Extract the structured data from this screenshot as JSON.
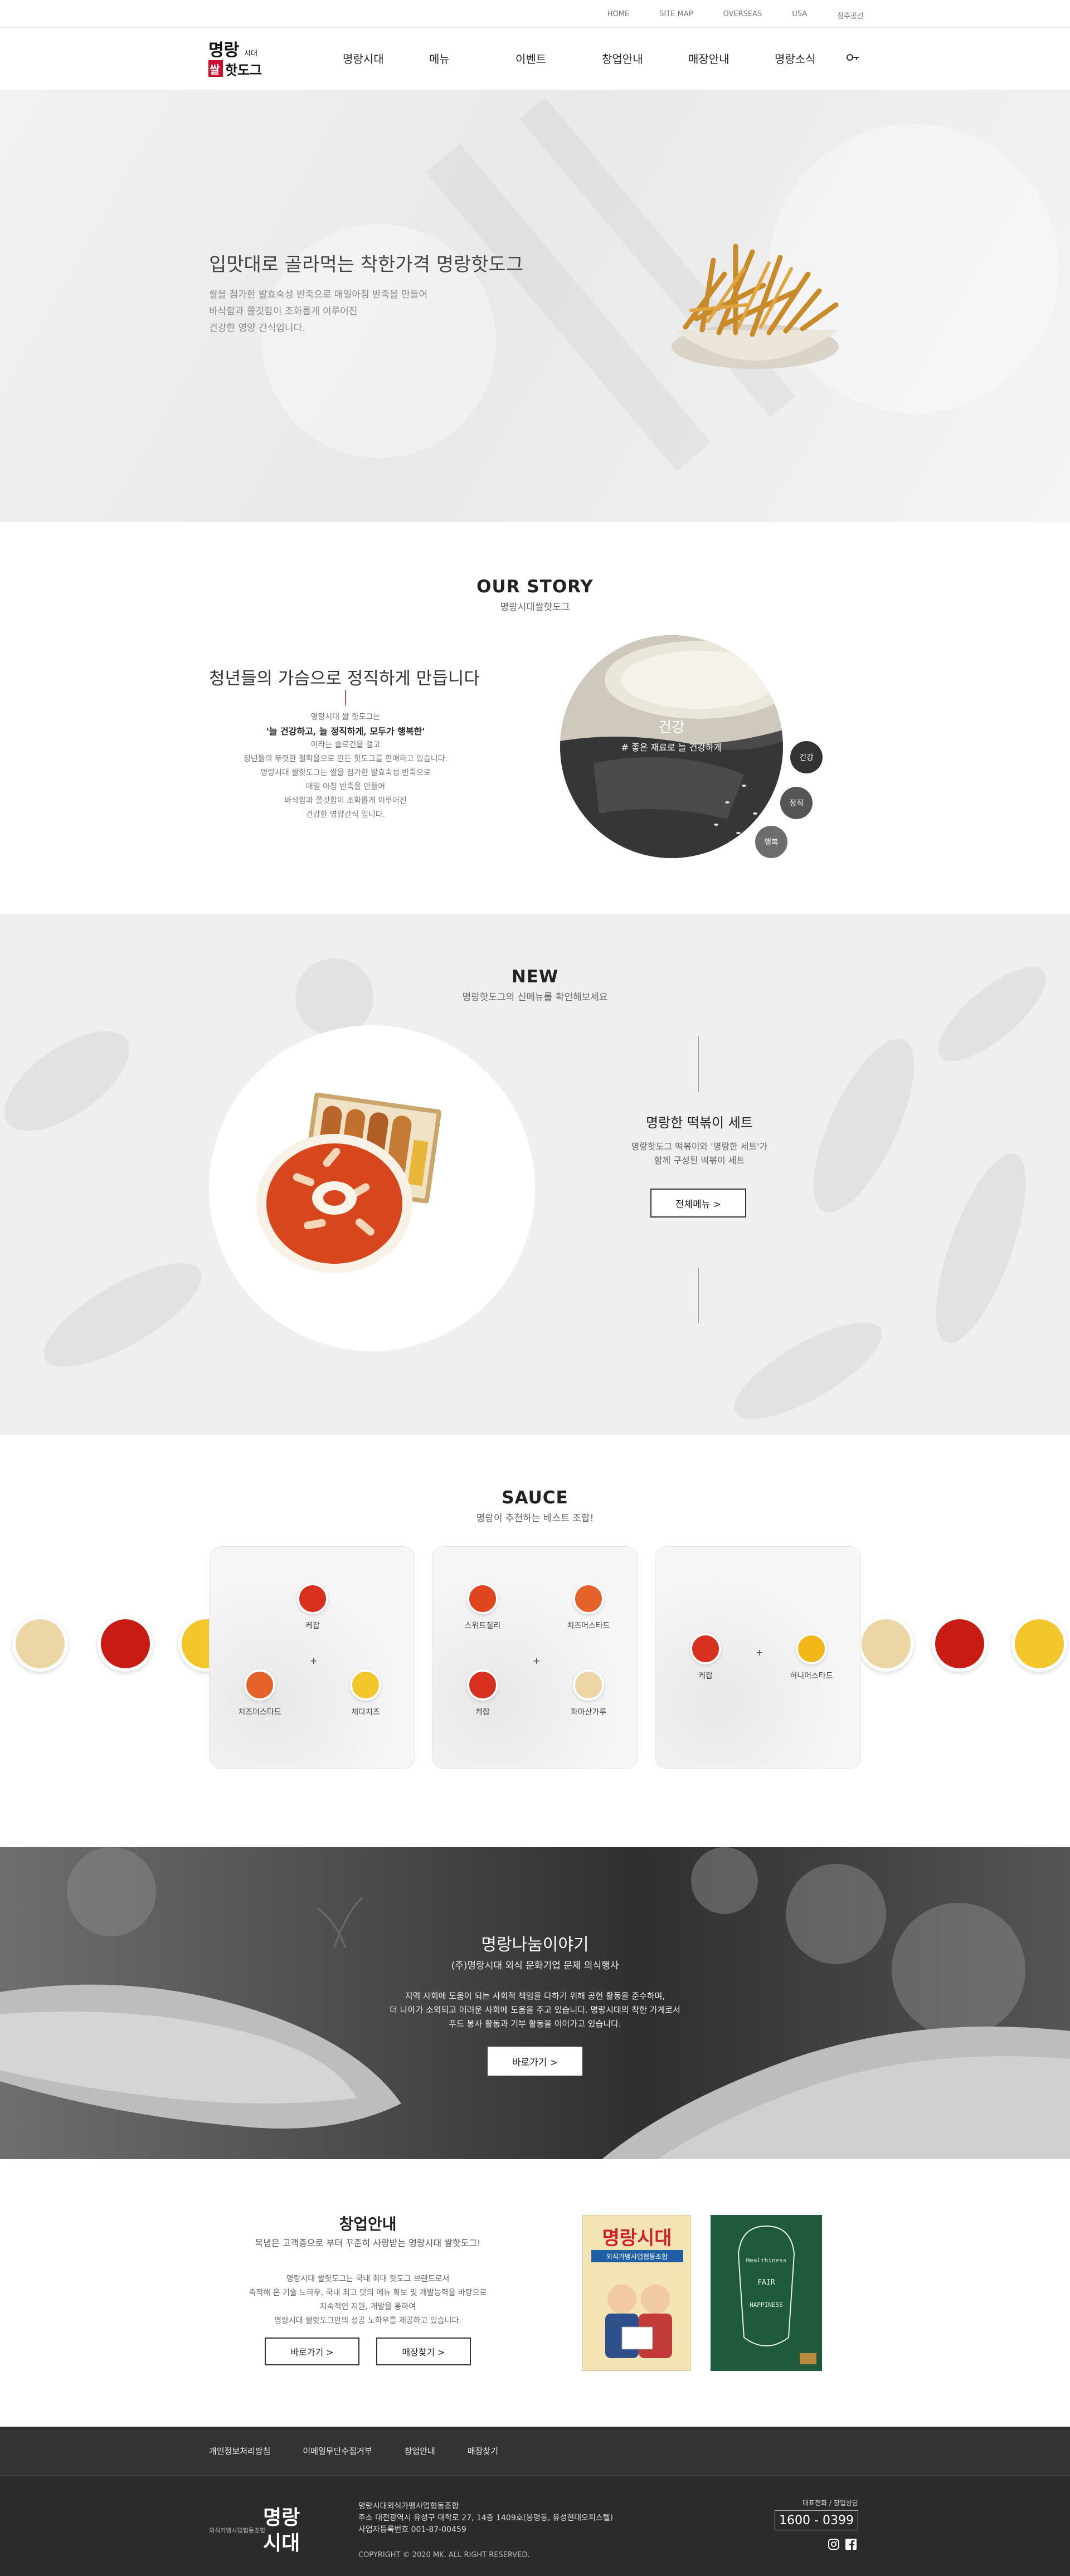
{
  "utility": {
    "links": [
      "HOME",
      "SITE MAP",
      "OVERSEAS",
      "USA",
      "점주공간"
    ]
  },
  "header": {
    "logo_text_top": "명랑",
    "logo_text_bottom": "쌀 핫도그",
    "logo_text_small": "시대",
    "nav": [
      "명랑시대",
      "메뉴",
      "이벤트",
      "창업안내",
      "매장안내",
      "명랑소식"
    ],
    "key_icon": "key-icon"
  },
  "hero": {
    "title": "입맛대로 골라먹는 착한가격 명랑핫도그",
    "desc": [
      "쌀을 첨가한 발효숙성 반죽으로 매일아침 반죽을 만들어",
      "바삭함과 쫄깃함이 조화롭게 이루어진",
      "건강한 영양 간식입니다."
    ]
  },
  "story": {
    "heading": "OUR STORY",
    "subheading": "명랑시대쌀핫도그",
    "title": "청년들의 가슴으로 정직하게 만듭니다",
    "lines": [
      "명랑시대 쌀 핫도그는",
      "'늘 건강하고, 늘 정직하게, 모두가 행복한'",
      "이라는 슬로건을 걸고",
      "청년들의 뚜렷한 철학을으로 만든 핫도그를 판매하고 있습니다.",
      "명랑시대 쌀핫도그는 쌀을 첨가한 발효숙성 반죽으로",
      "매일 아침 반죽을 만들어",
      "바삭함과 쫄깃함이 조화롭게 이루어진",
      "건강한 영양간식 입니다."
    ],
    "photo_label": "건강",
    "photo_sub": "# 좋은 재료로 늘 건강하게",
    "buttons": [
      "건강",
      "정직",
      "행복"
    ],
    "colors": {
      "dark": "#333333",
      "mid": "#555555",
      "light": "#6d6d6d",
      "accent": "#d34a6a"
    }
  },
  "new": {
    "heading": "NEW",
    "subheading": "명랑핫도그의 신메뉴를 확인해보세요",
    "title": "명랑한 떡볶이 세트",
    "desc": [
      "명랑핫도그 떡볶이와 '명랑한 세트'가",
      "함께 구성된 떡볶이 세트"
    ],
    "button": "전체메뉴 >"
  },
  "sauce": {
    "heading": "SAUCE",
    "subheading": "명랑이 추천하는 베스트 조합!",
    "cards": [
      {
        "items": [
          {
            "name": "케찹",
            "color": "#d8301e"
          },
          {
            "name": "치즈머스타드",
            "color": "#e5622a"
          },
          {
            "name": "체다치즈",
            "color": "#f3c62b"
          }
        ]
      },
      {
        "items": [
          {
            "name": "스위트칠리",
            "color": "#e0461d"
          },
          {
            "name": "치즈머스타드",
            "color": "#e5622a"
          },
          {
            "name": "케찹",
            "color": "#d8301e"
          },
          {
            "name": "파마산가루",
            "color": "#ecd6a6"
          }
        ]
      },
      {
        "items": [
          {
            "name": "케찹",
            "color": "#d8301e"
          },
          {
            "name": "허니머스타드",
            "color": "#f2b817"
          }
        ]
      }
    ],
    "plus": "+"
  },
  "share": {
    "title": "명랑나눔이야기",
    "subtitle": "(주)명랑시대 외식 문화기업 문제 의식행사",
    "desc": [
      "지역 사회에 도움이 되는 사회적 책임을 다하기 위해 공헌 활동을 준수하며,",
      "더 나아가 소외되고 어려운 사회에 도움을 주고 있습니다. 명랑시대의 착한 가게로서",
      "푸드 봉사 활동과 기부 활동을 이어가고 있습니다."
    ],
    "button": "바로가기 >"
  },
  "franchise": {
    "title": "창업안내",
    "subtitle": "목념은 고객층으로 부터 꾸준히 사랑받는 명랑시대 쌀핫도그!",
    "desc": [
      "명랑시대 쌀핫도그는 국내 최대 핫도그 브랜드로서",
      "축적해 온 기술 노하우, 국내 최고 맛의 메뉴 확보 및 개발능력을 바탕으로",
      "지속적인 지원, 개발을 통하여",
      "명랑시대 쌀핫도그만의 성공 노하우를 제공하고 있습니다."
    ],
    "buttons": [
      "바로가기 >",
      "매장찾기 >"
    ],
    "poster1": {
      "title": "명랑시대",
      "sub": "외식가맹사업협동조합"
    },
    "poster2": {
      "words": [
        "Healthiness",
        "FAIR",
        "HAPPINESS"
      ]
    }
  },
  "footer": {
    "nav": [
      "개인정보처리방침",
      "이메일무단수집거부",
      "창업안내",
      "매장찾기"
    ],
    "small_label": "외식가맹사업협동조합",
    "logo_top": "명랑",
    "logo_bottom": "시대",
    "info": [
      "명랑시대외식가맹사업협동조합",
      "주소 대전광역시 유성구 대학로 27, 14층 1409호(봉명동, 유성현대오피스텔)",
      "사업자등록번호 001-87-00459"
    ],
    "copyright": "COPYRIGHT © 2020 MK. ALL RIGHT RESERVED.",
    "cs_label": "대표전화 / 창업상담",
    "phone": "1600 - 0399"
  }
}
